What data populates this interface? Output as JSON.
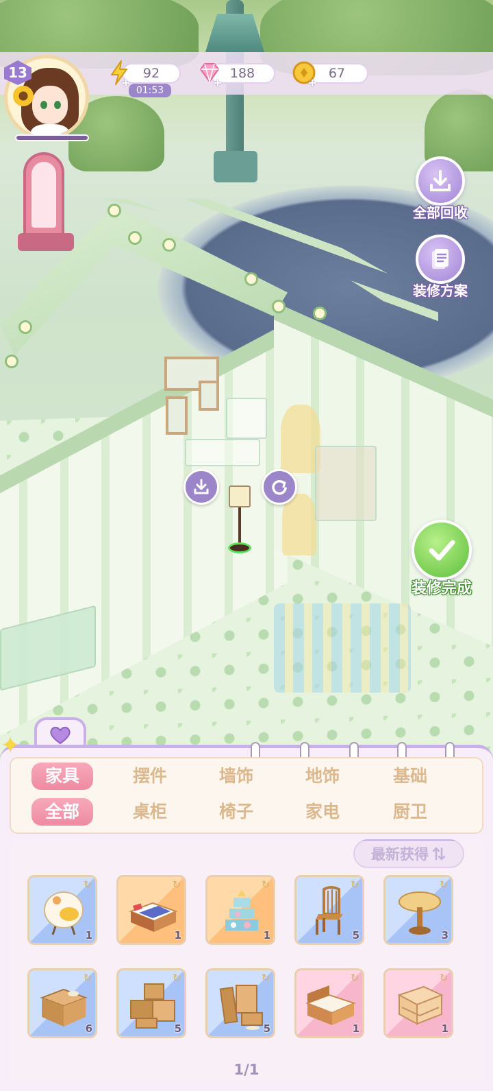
{
  "hud": {
    "level": "13",
    "energy": "92",
    "energy_timer": "01:53",
    "gems": "188",
    "coins": "67"
  },
  "side_buttons": {
    "recycle_all": "全部回收",
    "decor_plan": "装修方案",
    "decor_done": "装修完成"
  },
  "categories": {
    "main": [
      "家具",
      "摆件",
      "墙饰",
      "地饰",
      "基础"
    ],
    "sub": [
      "全部",
      "桌柜",
      "椅子",
      "家电",
      "厨卫"
    ],
    "active_main": "家具",
    "active_sub": "全部"
  },
  "sort_label": "最新获得",
  "items": [
    {
      "icon": "egg-chair-icon",
      "count": "1",
      "bg": "blue"
    },
    {
      "icon": "bed-blue-icon",
      "count": "1",
      "bg": "orange"
    },
    {
      "icon": "cake-shelf-icon",
      "count": "1",
      "bg": "orange"
    },
    {
      "icon": "wooden-chair-icon",
      "count": "5",
      "bg": "blue"
    },
    {
      "icon": "round-table-icon",
      "count": "3",
      "bg": "blue"
    },
    {
      "icon": "cardboard-box-icon",
      "count": "6",
      "bg": "blue"
    },
    {
      "icon": "box-pile-icon",
      "count": "5",
      "bg": "blue"
    },
    {
      "icon": "box-stack-icon",
      "count": "5",
      "bg": "blue"
    },
    {
      "icon": "double-bed-icon",
      "count": "1",
      "bg": "pink"
    },
    {
      "icon": "sofa-icon",
      "count": "1",
      "bg": "pink"
    }
  ],
  "page_indicator": "1/1",
  "colors": {
    "accent_purple": "#9b86c9",
    "active_tab_pink": "#ef8aa2",
    "tab_text": "#dcb88e",
    "done_green": "#5cbf3c"
  }
}
